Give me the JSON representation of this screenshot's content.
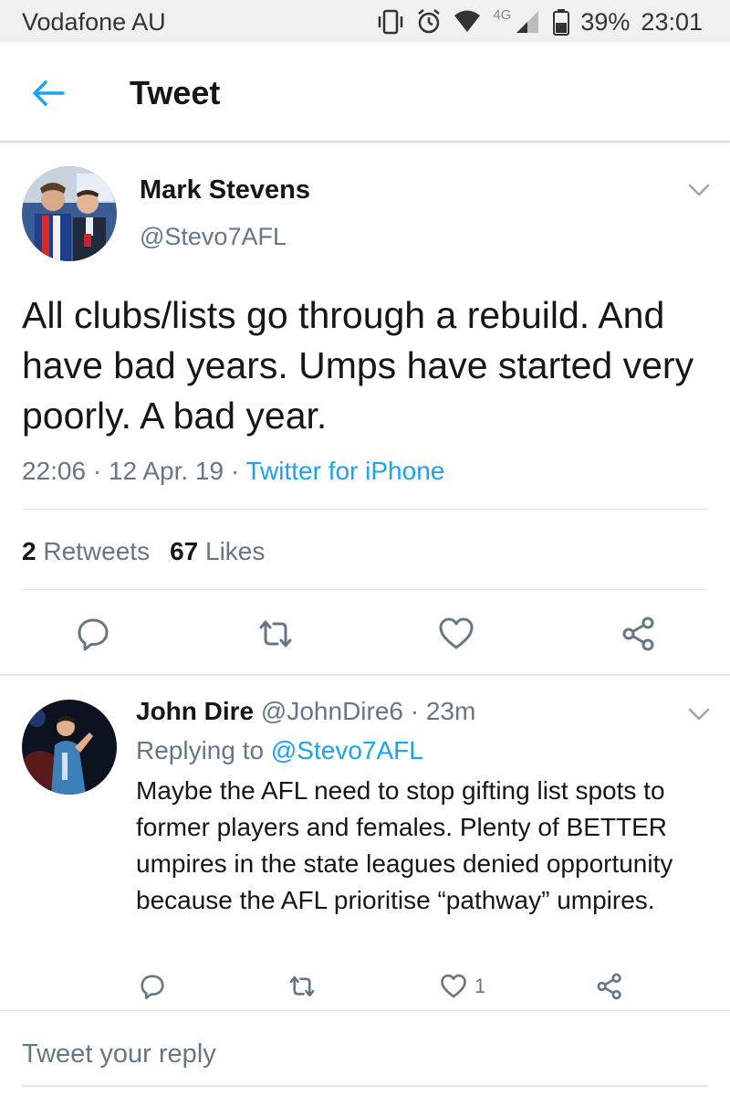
{
  "status_bar": {
    "carrier": "Vodafone AU",
    "network": "4G",
    "battery": "39%",
    "time": "23:01",
    "icons": [
      "vibrate-icon",
      "alarm-icon",
      "wifi-icon",
      "signal-icon",
      "battery-icon"
    ]
  },
  "header": {
    "title": "Tweet",
    "back_icon": "arrow-left-icon",
    "accent": "#1da1f2"
  },
  "tweet": {
    "author_name": "Mark Stevens",
    "author_handle": "@Stevo7AFL",
    "text": "All clubs/lists go through a rebuild. And have bad years. Umps have started very poorly. A bad year.",
    "time": "22:06",
    "date": "12 Apr. 19",
    "separator": "·",
    "source": "Twitter for iPhone",
    "retweets_count": "2",
    "retweets_label": "Retweets",
    "likes_count": "67",
    "likes_label": "Likes",
    "actions": [
      "reply-icon",
      "retweet-icon",
      "like-icon",
      "share-icon"
    ]
  },
  "reply": {
    "author_name": "John Dire",
    "author_handle": "@JohnDire6",
    "separator": "·",
    "time_ago": "23m",
    "replying_prefix": "Replying to",
    "replying_to": "@Stevo7AFL",
    "text": "Maybe the AFL need to stop gifting list spots to former players and females. Plenty of BETTER umpires in the state leagues denied opportunity because the AFL prioritise “pathway” umpires.",
    "like_count": "1"
  },
  "composer": {
    "placeholder": "Tweet your reply"
  },
  "colors": {
    "link": "#1da1f2",
    "secondary_text": "#657786",
    "primary_text": "#14171a",
    "divider": "#e1e8ed"
  }
}
